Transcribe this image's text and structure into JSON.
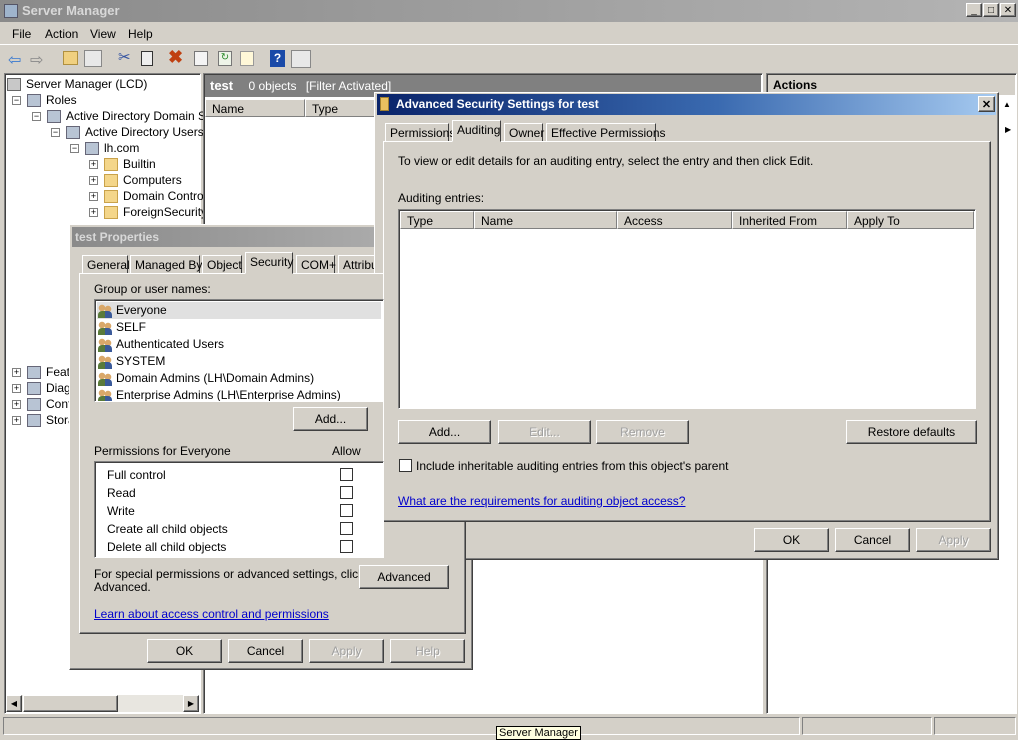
{
  "window": {
    "title": "Server Manager",
    "controls": [
      "minimize",
      "maximize",
      "close"
    ]
  },
  "menu": [
    "File",
    "Action",
    "View",
    "Help"
  ],
  "toolbar": [
    "back-icon",
    "forward-icon",
    "up-folder-icon",
    "show-hide-tree-icon",
    "cut-icon",
    "paste-icon",
    "delete-icon",
    "properties-icon",
    "refresh-icon",
    "export-icon",
    "help-icon",
    "show-hide-action-pane-icon"
  ],
  "tree": {
    "root": "Server Manager (LCD)",
    "items": [
      {
        "label": "Roles",
        "exp": "−"
      },
      {
        "label": "Active Directory Domain Se",
        "exp": "−"
      },
      {
        "label": "Active Directory Users a",
        "exp": "−"
      },
      {
        "label": "lh.com",
        "exp": "−"
      },
      {
        "label": "Builtin",
        "exp": "+"
      },
      {
        "label": "Computers",
        "exp": "+"
      },
      {
        "label": "Domain Control",
        "exp": "+"
      },
      {
        "label": "ForeignSecurity",
        "exp": "+"
      },
      {
        "label": "Feat",
        "exp": "+"
      },
      {
        "label": "Diag",
        "exp": "+"
      },
      {
        "label": "Conf",
        "exp": "+"
      },
      {
        "label": "Stora",
        "exp": "+"
      }
    ]
  },
  "middle": {
    "title": "test",
    "count": "0 objects",
    "filter": "[Filter Activated]",
    "columns": [
      "Name",
      "Type"
    ]
  },
  "actions": {
    "title": "Actions"
  },
  "status": {
    "tooltip": "Server Manager"
  },
  "props": {
    "title": "test Properties",
    "tabs": [
      "General",
      "Managed By",
      "Object",
      "Security",
      "COM+",
      "Attribut"
    ],
    "selected_tab": "Security",
    "group_label": "Group or user names:",
    "users": [
      "Everyone",
      "SELF",
      "Authenticated Users",
      "SYSTEM",
      "Domain Admins (LH\\Domain Admins)",
      "Enterprise Admins (LH\\Enterprise Admins)"
    ],
    "add": "Add...",
    "perm_label": "Permissions for Everyone",
    "allow": "Allow",
    "perms": [
      {
        "name": "Full control",
        "allow": false
      },
      {
        "name": "Read",
        "allow": false
      },
      {
        "name": "Write",
        "allow": false
      },
      {
        "name": "Create all child objects",
        "allow": false
      },
      {
        "name": "Delete all child objects",
        "allow": false
      }
    ],
    "special1": "For special permissions or advanced settings, click",
    "special2": "Advanced.",
    "advanced": "Advanced",
    "link": "Learn about access control and permissions",
    "ok": "OK",
    "cancel": "Cancel",
    "apply": "Apply",
    "help": "Help"
  },
  "adv": {
    "title": "Advanced Security Settings for test",
    "tabs": [
      "Permissions",
      "Auditing",
      "Owner",
      "Effective Permissions"
    ],
    "selected_tab": "Auditing",
    "instructions": "To view or edit details for an auditing entry, select the entry and then click Edit.",
    "entries_label": "Auditing entries:",
    "columns": [
      "Type",
      "Name",
      "Access",
      "Inherited From",
      "Apply To"
    ],
    "entries": [],
    "add": "Add...",
    "edit": "Edit...",
    "remove": "Remove",
    "restore": "Restore defaults",
    "inherit_label": "Include inheritable auditing entries from this object's parent",
    "inherit_checked": false,
    "link": "What are the requirements for auditing object access?",
    "ok": "OK",
    "cancel": "Cancel",
    "apply": "Apply"
  }
}
